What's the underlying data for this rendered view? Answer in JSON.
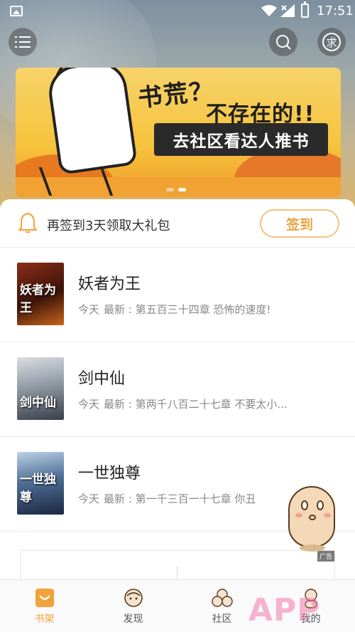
{
  "status_bar": {
    "time": "17:51",
    "icons": [
      "image-icon",
      "wifi-icon",
      "signal-icon",
      "battery-icon"
    ]
  },
  "header": {
    "menu_icon": "menu-icon",
    "search_icon": "search-icon",
    "request_label": "求"
  },
  "banner": {
    "title_line1": "书荒？",
    "title_line2": "不存在的!!",
    "board_text": "去社区看达人推书",
    "dots": 2,
    "active_dot": 2
  },
  "signin": {
    "text": "再签到3天领取大礼包",
    "button": "签到"
  },
  "books": [
    {
      "title": "妖者为王",
      "cover_text": "妖者为王",
      "day": "今天",
      "latest": "最新 : 第五百三十四章 恐怖的速度!"
    },
    {
      "title": "剑中仙",
      "cover_text": "剑中仙",
      "day": "今天",
      "latest": "最新 : 第两千八百二十七章 不要太小..."
    },
    {
      "title": "一世独尊",
      "cover_text": "一世独尊",
      "day": "今天",
      "latest": "最新 : 第一千三百一十七章 你丑"
    }
  ],
  "ad": {
    "tag": "广告"
  },
  "bottom_nav": [
    {
      "label": "书架",
      "icon": "bookshelf-icon",
      "active": true
    },
    {
      "label": "发现",
      "icon": "discover-icon",
      "active": false
    },
    {
      "label": "社区",
      "icon": "community-icon",
      "active": false
    },
    {
      "label": "我的",
      "icon": "profile-icon",
      "active": false
    }
  ],
  "watermark": "APP",
  "colors": {
    "accent": "#f2a23a",
    "signin_border": "#f3c27d",
    "text_primary": "#222222",
    "text_secondary": "#888888"
  }
}
